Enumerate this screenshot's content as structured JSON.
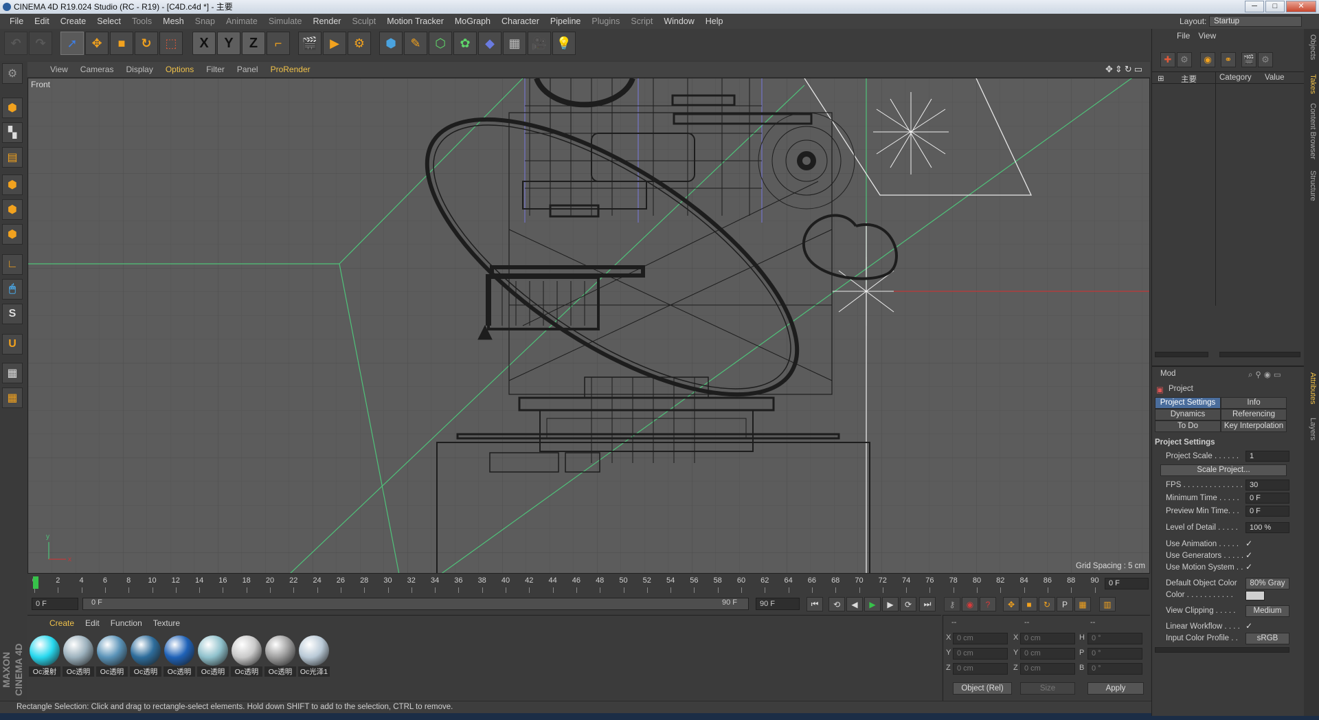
{
  "window": {
    "title": "CINEMA 4D R19.024 Studio (RC - R19) - [C4D.c4d *] - 主要",
    "min": "─",
    "max": "□",
    "close": "✕"
  },
  "menu": [
    "File",
    "Edit",
    "Create",
    "Select",
    "Tools",
    "Mesh",
    "Snap",
    "Animate",
    "Simulate",
    "Render",
    "Sculpt",
    "Motion Tracker",
    "MoGraph",
    "Character",
    "Pipeline",
    "Plugins",
    "Script",
    "Window",
    "Help"
  ],
  "layout": {
    "label": "Layout:",
    "value": "Startup"
  },
  "toolbar": {
    "axis_x": "X",
    "axis_y": "Y",
    "axis_z": "Z"
  },
  "viewport": {
    "menu": [
      "View",
      "Cameras",
      "Display",
      "Options",
      "Filter",
      "Panel",
      "ProRender"
    ],
    "name": "Front",
    "grid_spacing": "Grid Spacing : 5 cm",
    "axis_y": "y",
    "axis_x": "x"
  },
  "timeline": {
    "ticks": [
      "0",
      "2",
      "4",
      "6",
      "8",
      "10",
      "12",
      "14",
      "16",
      "18",
      "20",
      "22",
      "24",
      "26",
      "28",
      "30",
      "32",
      "34",
      "36",
      "38",
      "40",
      "42",
      "44",
      "46",
      "48",
      "50",
      "52",
      "54",
      "56",
      "58",
      "60",
      "62",
      "64",
      "66",
      "68",
      "70",
      "72",
      "74",
      "76",
      "78",
      "80",
      "82",
      "84",
      "86",
      "88",
      "90"
    ],
    "current": "0 F",
    "start": "0 F",
    "range_start": "0 F",
    "range_end": "90 F",
    "end": "90 F"
  },
  "materials": {
    "menu": [
      "Create",
      "Edit",
      "Function",
      "Texture"
    ],
    "items": [
      {
        "label": "Oc漫射",
        "color": "#27d8ee"
      },
      {
        "label": "Oc透明",
        "color": "#9cb1bd"
      },
      {
        "label": "Oc透明",
        "color": "#5a93b8"
      },
      {
        "label": "Oc透明",
        "color": "#2e6d9c"
      },
      {
        "label": "Oc透明",
        "color": "#1f62b8"
      },
      {
        "label": "Oc透明",
        "color": "#8fc1cc"
      },
      {
        "label": "Oc透明",
        "color": "#c9c9c9"
      },
      {
        "label": "Oc透明",
        "color": "#9e9e9e"
      },
      {
        "label": "Oc光泽1",
        "color": "#b9c9d6"
      }
    ]
  },
  "coords": {
    "headers": [
      "--",
      "--",
      "--"
    ],
    "rows": [
      {
        "a": "X",
        "av": "0 cm",
        "b": "X",
        "bv": "0 cm",
        "c": "H",
        "cv": "0 °"
      },
      {
        "a": "Y",
        "av": "0 cm",
        "b": "Y",
        "bv": "0 cm",
        "c": "P",
        "cv": "0 °"
      },
      {
        "a": "Z",
        "av": "0 cm",
        "b": "Z",
        "bv": "0 cm",
        "c": "B",
        "cv": "0 °"
      }
    ],
    "mode": "Object (Rel)",
    "size": "Size",
    "apply": "Apply"
  },
  "brand": "MAXON CINEMA 4D",
  "status": "Rectangle Selection: Click and drag to rectangle-select elements. Hold down SHIFT to add to the selection, CTRL to remove.",
  "objects": {
    "menu": [
      "File",
      "View"
    ],
    "item": "主要",
    "col_category": "Category",
    "col_value": "Value"
  },
  "right_tabs": [
    "Objects",
    "Takes",
    "Content Browser",
    "Structure",
    "Attributes",
    "Layers"
  ],
  "attributes": {
    "mode": "Mod",
    "title": "Project",
    "tabs": [
      "Project Settings",
      "Info",
      "Dynamics",
      "Referencing",
      "To Do",
      "Key Interpolation"
    ],
    "section": "Project Settings",
    "project_scale": {
      "label": "Project Scale . . . . . .",
      "value": "1"
    },
    "scale_btn": "Scale Project...",
    "fps": {
      "label": "FPS . . . . . . . . . . . . . . .",
      "value": "30"
    },
    "min_time": {
      "label": "Minimum Time . . . . .",
      "value": "0 F"
    },
    "prev_min_time": {
      "label": "Preview Min Time. . .",
      "value": "0 F"
    },
    "lod": {
      "label": "Level of Detail . . . . .",
      "value": "100 %"
    },
    "use_anim": {
      "label": "Use Animation . . . . .",
      "value": "✓"
    },
    "use_gen": {
      "label": "Use Generators . . . . .",
      "value": "✓"
    },
    "use_motion": {
      "label": "Use Motion System . .",
      "value": "✓"
    },
    "def_obj_color": {
      "label": "Default Object Color",
      "value": "80% Gray"
    },
    "color": {
      "label": "Color . . . . . . . . . . ."
    },
    "view_clip": {
      "label": "View Clipping . . . . .",
      "value": "Medium"
    },
    "lin_workflow": {
      "label": "Linear Workflow . . . .",
      "value": "✓"
    },
    "input_profile": {
      "label": "Input Color Profile . .",
      "value": "sRGB"
    }
  }
}
